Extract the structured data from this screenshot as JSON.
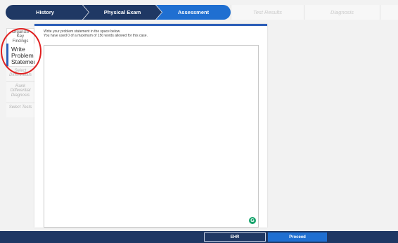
{
  "steps": [
    {
      "label": "History"
    },
    {
      "label": "Physical Exam"
    },
    {
      "label": "Assessment"
    },
    {
      "label": "Test Results"
    },
    {
      "label": "Diagnosis"
    }
  ],
  "sidetabs": {
    "organize": "Organize Key Findings",
    "write": "Write Problem Statement",
    "select_differentials": "Select Differentials",
    "rank": "Rank Differential Diagnosis",
    "select_tests": "Select Tests"
  },
  "panel": {
    "instruction_line1": "Write your problem statement in the space below.",
    "instruction_line2": "You have used 0 of a maximum of 150 words allowed for this case.",
    "textarea_value": "",
    "assist_icon_glyph": "G"
  },
  "footer": {
    "ehr_label": "EHR",
    "proceed_label": "Proceed"
  },
  "colors": {
    "nav_dark": "#1f3864",
    "accent": "#1f6fd1",
    "annotation": "#e02020",
    "assist": "#15a36b"
  },
  "icons": {
    "assist": "grammarly-icon"
  }
}
